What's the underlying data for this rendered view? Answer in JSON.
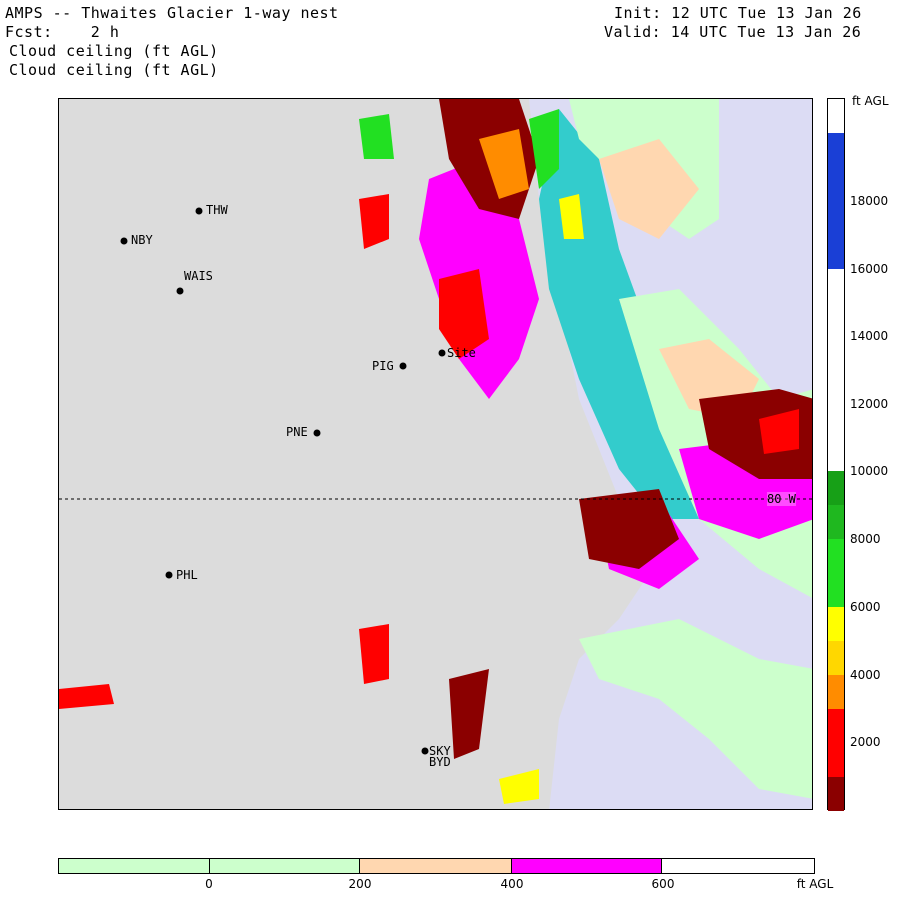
{
  "header": {
    "title": "AMPS -- Thwaites Glacier 1-way nest",
    "fcst_label": "Fcst:",
    "fcst_value": "2 h",
    "field_line1": "Cloud ceiling (ft AGL)",
    "field_line2": "Cloud ceiling (ft AGL)",
    "init": "Init: 12 UTC Tue 13 Jan 26",
    "valid": "Valid: 14 UTC Tue 13 Jan 26"
  },
  "map": {
    "latitude_label": "80 W",
    "stations": [
      {
        "name": "THW"
      },
      {
        "name": "NBY"
      },
      {
        "name": "WAIS"
      },
      {
        "name": "PIG"
      },
      {
        "name": "Site"
      },
      {
        "name": "PNE"
      },
      {
        "name": "PHL"
      },
      {
        "name": "SKY"
      },
      {
        "name": "BYD"
      }
    ]
  },
  "colorbar_right": {
    "unit": "ft AGL",
    "labels": [
      "18000",
      "16000",
      "14000",
      "12000",
      "10000",
      "8000",
      "6000",
      "4000",
      "2000"
    ],
    "colors": [
      "#ffffff",
      "#1a3fd6",
      "#ffffff",
      "#ffffff",
      "#ffffff",
      "#ffffff",
      "#17a017",
      "#1fc91f",
      "#22e022",
      "#ffff00",
      "#ffd700",
      "#ff8c00",
      "#ff0000",
      "#8b0000"
    ]
  },
  "colorbar_bottom": {
    "unit": "ft AGL",
    "labels": [
      "0",
      "200",
      "400",
      "600"
    ],
    "colors": [
      "#ccffcc",
      "#ccffcc",
      "#ffd7b0",
      "#ff00ff",
      "#ffffff"
    ]
  }
}
